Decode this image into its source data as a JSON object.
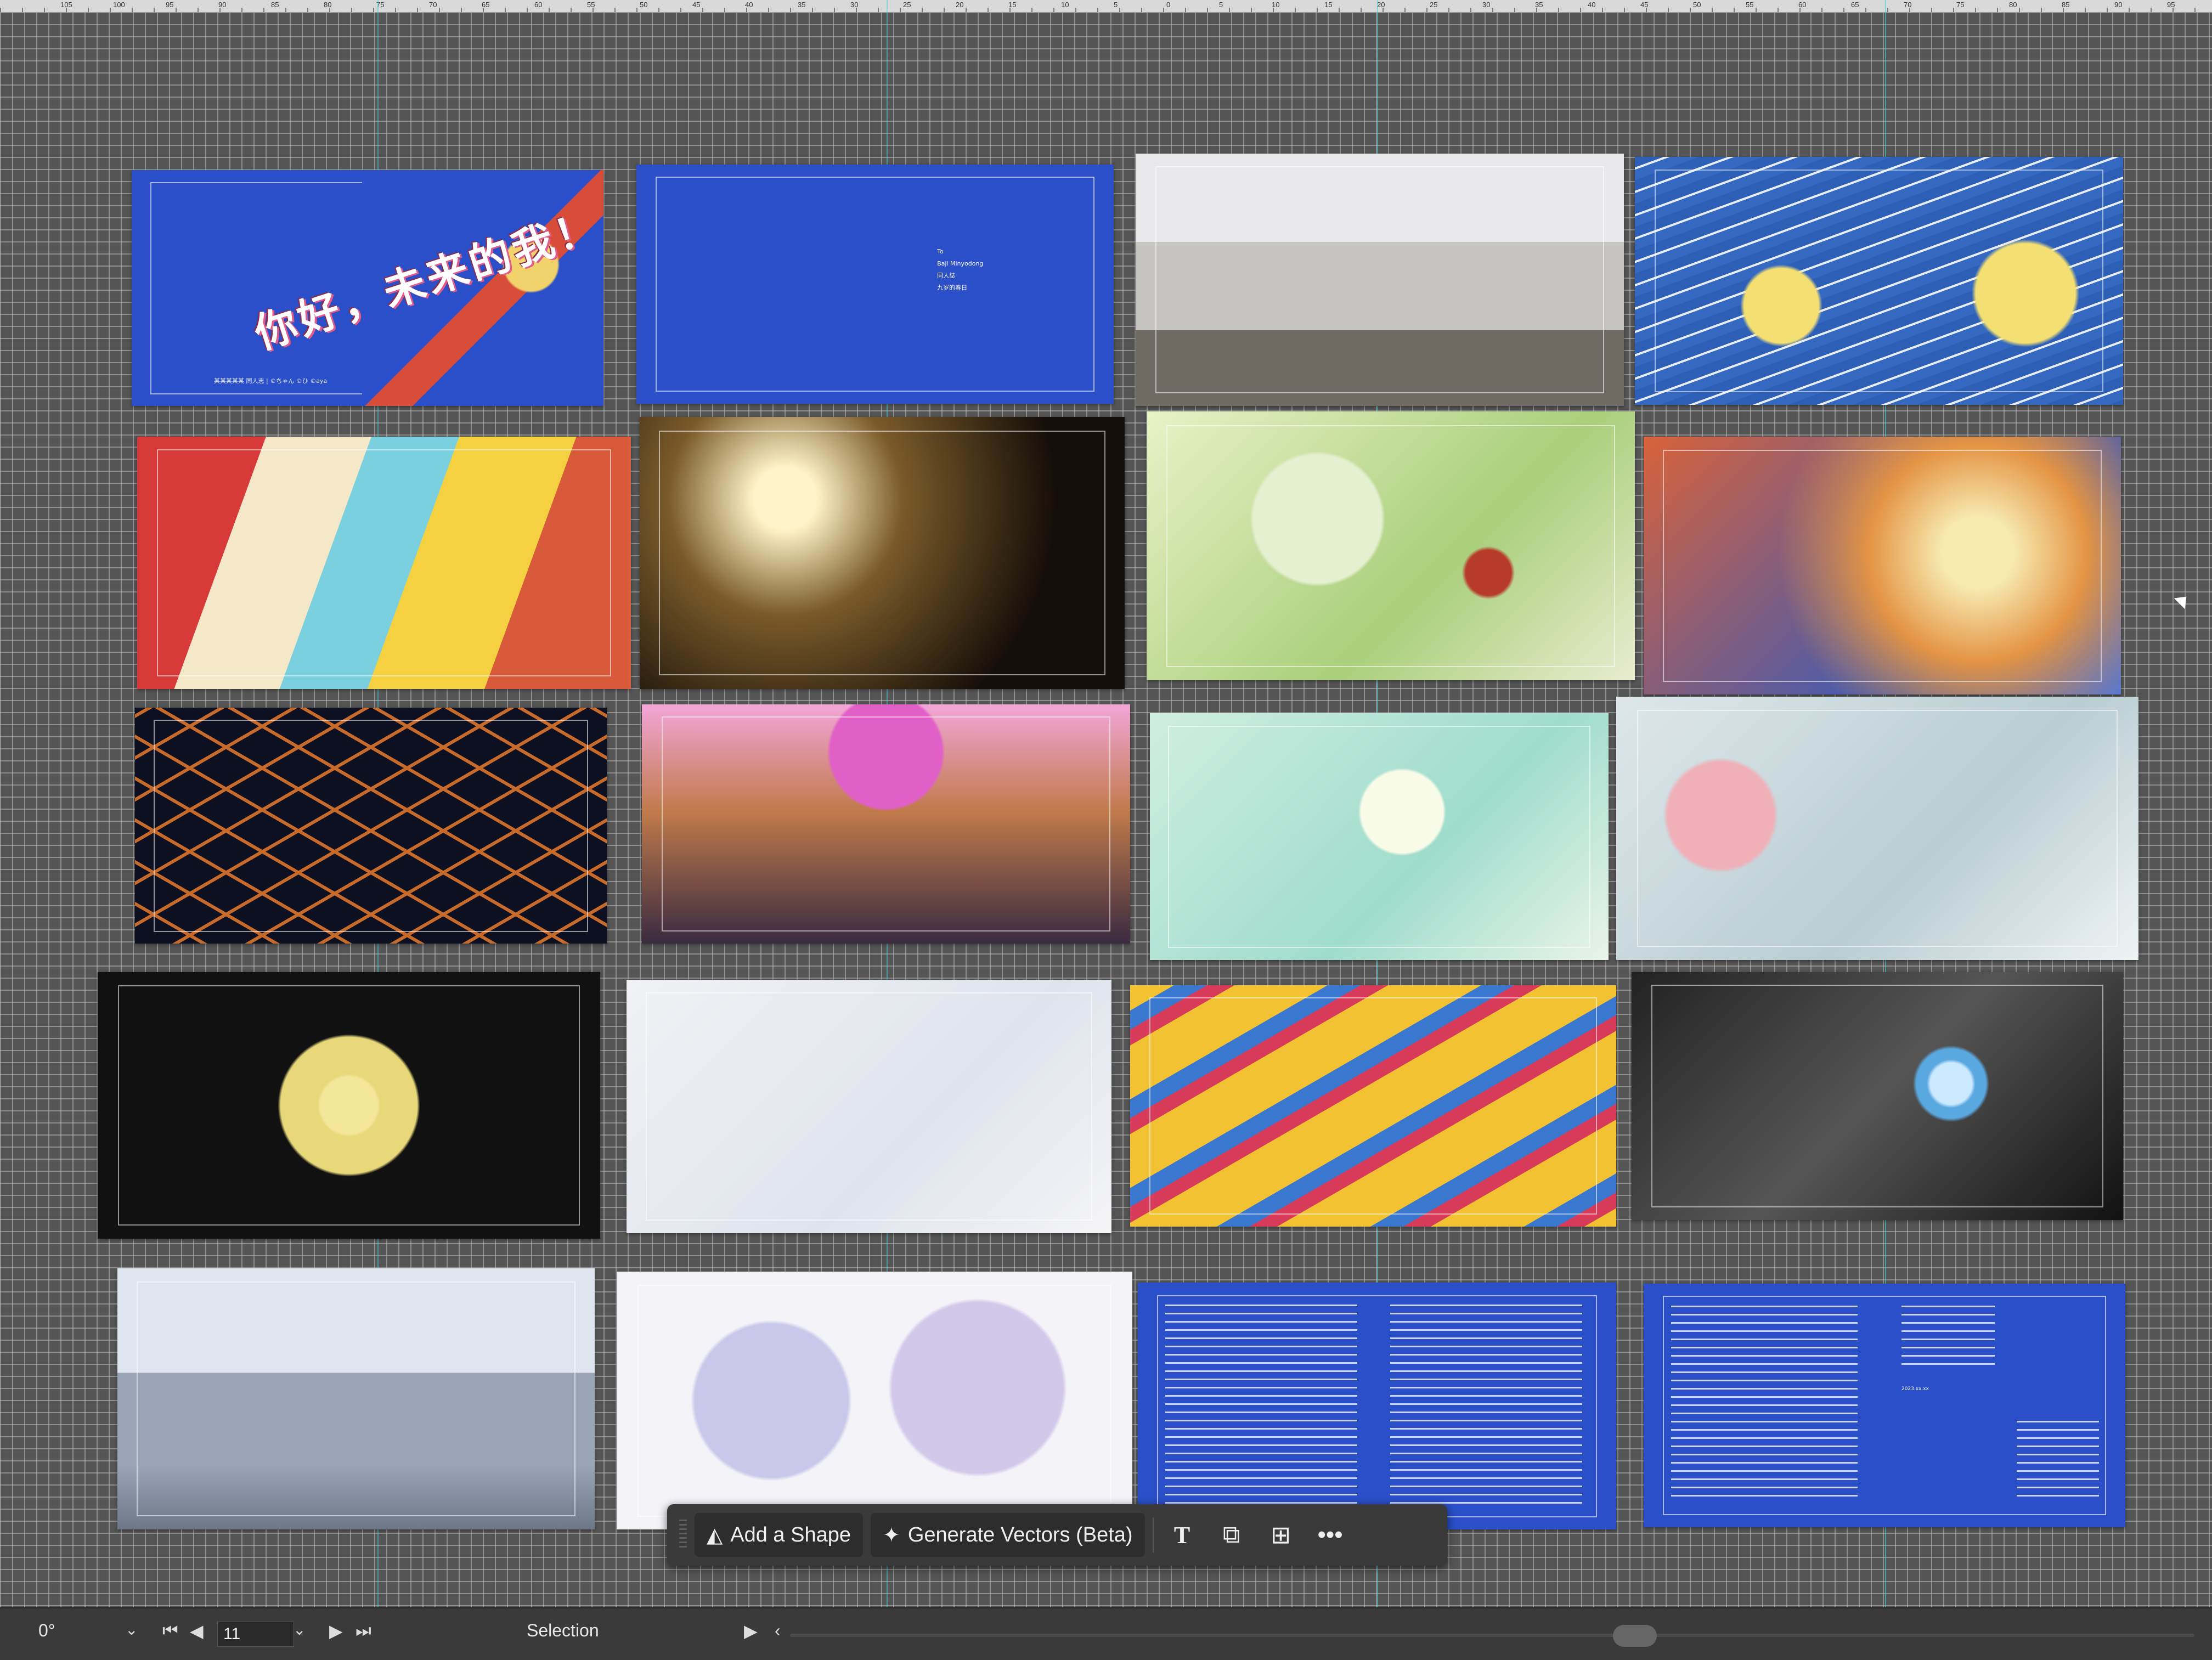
{
  "ruler": {
    "ticks": [
      "105",
      "100",
      "95",
      "90",
      "85",
      "80",
      "75",
      "70",
      "65",
      "60",
      "55",
      "50",
      "45",
      "40",
      "35",
      "30",
      "25",
      "20",
      "15",
      "10",
      "5",
      "0",
      "5",
      "10",
      "15",
      "20",
      "25",
      "30",
      "35",
      "40",
      "45",
      "50",
      "55",
      "60",
      "65",
      "70",
      "75",
      "80",
      "85",
      "90",
      "95"
    ]
  },
  "spreads": [
    {
      "id": "cover-spread",
      "kind": "cover",
      "title": "你好，未来的我！",
      "credit": "某某某某某 同人志 | ©ちゃん ©ひ ©aya"
    },
    {
      "id": "imprint-spread",
      "kind": "blue-imprint",
      "lines": [
        "To",
        "Baji Minyodong",
        "同人誌",
        "九岁的春日"
      ]
    },
    {
      "id": "spread-classroom",
      "kind": "art",
      "style": "art-classroom"
    },
    {
      "id": "spread-ocean",
      "kind": "art",
      "style": "art-ocean"
    },
    {
      "id": "spread-cans",
      "kind": "art",
      "style": "art-cans"
    },
    {
      "id": "spread-music",
      "kind": "art",
      "style": "art-music"
    },
    {
      "id": "spread-cake",
      "kind": "art",
      "style": "art-cake"
    },
    {
      "id": "spread-chaos",
      "kind": "art",
      "style": "art-chaos"
    },
    {
      "id": "spread-night",
      "kind": "art",
      "style": "art-night"
    },
    {
      "id": "spread-group",
      "kind": "art",
      "style": "art-group"
    },
    {
      "id": "spread-mint",
      "kind": "art",
      "style": "art-mint"
    },
    {
      "id": "spread-lab",
      "kind": "art",
      "style": "art-lab"
    },
    {
      "id": "spread-burst",
      "kind": "art",
      "style": "art-burst"
    },
    {
      "id": "spread-sketch",
      "kind": "art",
      "style": "art-sketch"
    },
    {
      "id": "spread-ribbons",
      "kind": "art",
      "style": "art-ribbons"
    },
    {
      "id": "spread-bwflash",
      "kind": "art",
      "style": "art-bwflash"
    },
    {
      "id": "spread-city",
      "kind": "art",
      "style": "art-city"
    },
    {
      "id": "spread-sketch2",
      "kind": "art",
      "style": "art-sketch2"
    },
    {
      "id": "text-spread-1",
      "kind": "blue-text"
    },
    {
      "id": "text-spread-2",
      "kind": "blue-text",
      "date": "2023.xx.xx"
    }
  ],
  "contextbar": {
    "add_shape_label": "Add a Shape",
    "generate_vectors_label": "Generate Vectors (Beta)",
    "icons": {
      "add_shape": "shape-sparkle-icon",
      "generate_vectors": "ai-vectors-icon",
      "type": "type-tool-icon",
      "crop": "crop-artboard-icon",
      "place": "place-image-icon",
      "more": "more-options-icon"
    }
  },
  "statusbar": {
    "rotation": "0°",
    "artboard_number": "11",
    "tool_label": "Selection"
  },
  "colors": {
    "canvas": "#555555",
    "guide": "#3fd7e0",
    "blue_page": "#2a4fc8",
    "toolbar": "#3a3a3a"
  }
}
